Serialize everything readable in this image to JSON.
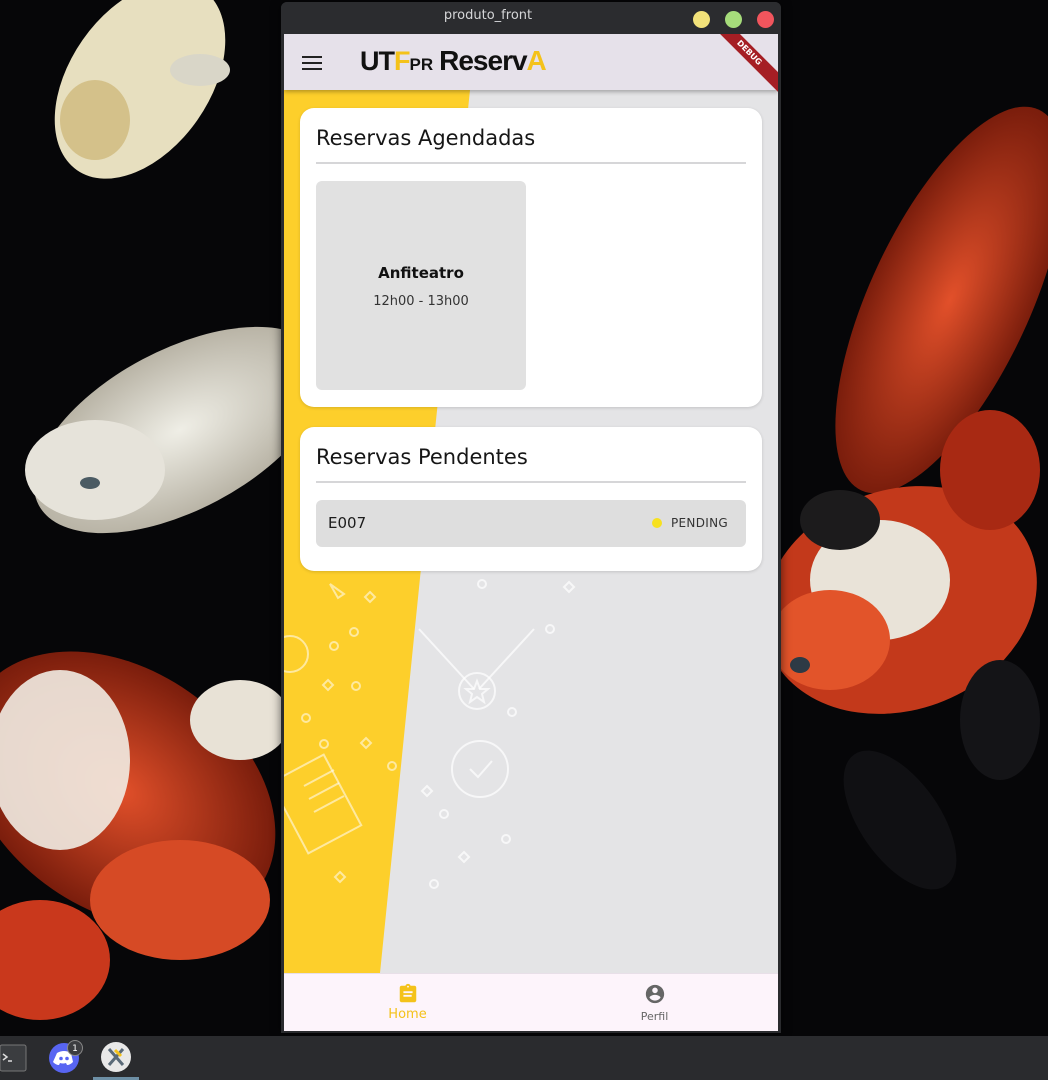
{
  "window": {
    "title": "produto_front"
  },
  "appbar": {
    "logo": {
      "part_ut": "UT",
      "part_f": "F",
      "part_pr": "PR",
      "part_reserv": "Reserv",
      "part_a": "A"
    },
    "debug_banner": "DEBUG"
  },
  "scheduled": {
    "title": "Reservas Agendadas",
    "items": [
      {
        "name": "Anfiteatro",
        "time": "12h00 - 13h00"
      }
    ]
  },
  "pending": {
    "title": "Reservas Pendentes",
    "items": [
      {
        "room": "E007",
        "status": "PENDING",
        "status_color": "#f7e11f"
      }
    ]
  },
  "bottom_nav": {
    "items": [
      {
        "label": "Home",
        "icon": "clipboard-icon",
        "active": true
      },
      {
        "label": "Perfil",
        "icon": "account-circle-icon",
        "active": false
      }
    ]
  },
  "taskbar": {
    "discord_badge": "1"
  },
  "colors": {
    "accent": "#f4c21a",
    "debug": "#a51e24",
    "background": "#e4e4e6"
  }
}
